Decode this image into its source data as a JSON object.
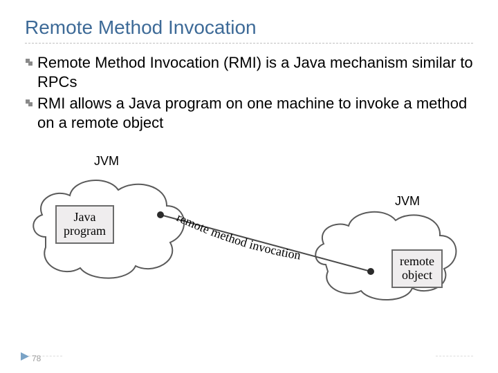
{
  "title": "Remote Method Invocation",
  "bullets": [
    "Remote Method Invocation (RMI) is a Java mechanism similar to RPCs",
    "RMI allows a Java program on one machine to invoke a method on a remote object"
  ],
  "diagram": {
    "jvm1_label": "JVM",
    "jvm2_label": "JVM",
    "box1": "Java\nprogram",
    "box2": "remote\nobject",
    "link_text": "remote method invocation"
  },
  "page_number": "78"
}
